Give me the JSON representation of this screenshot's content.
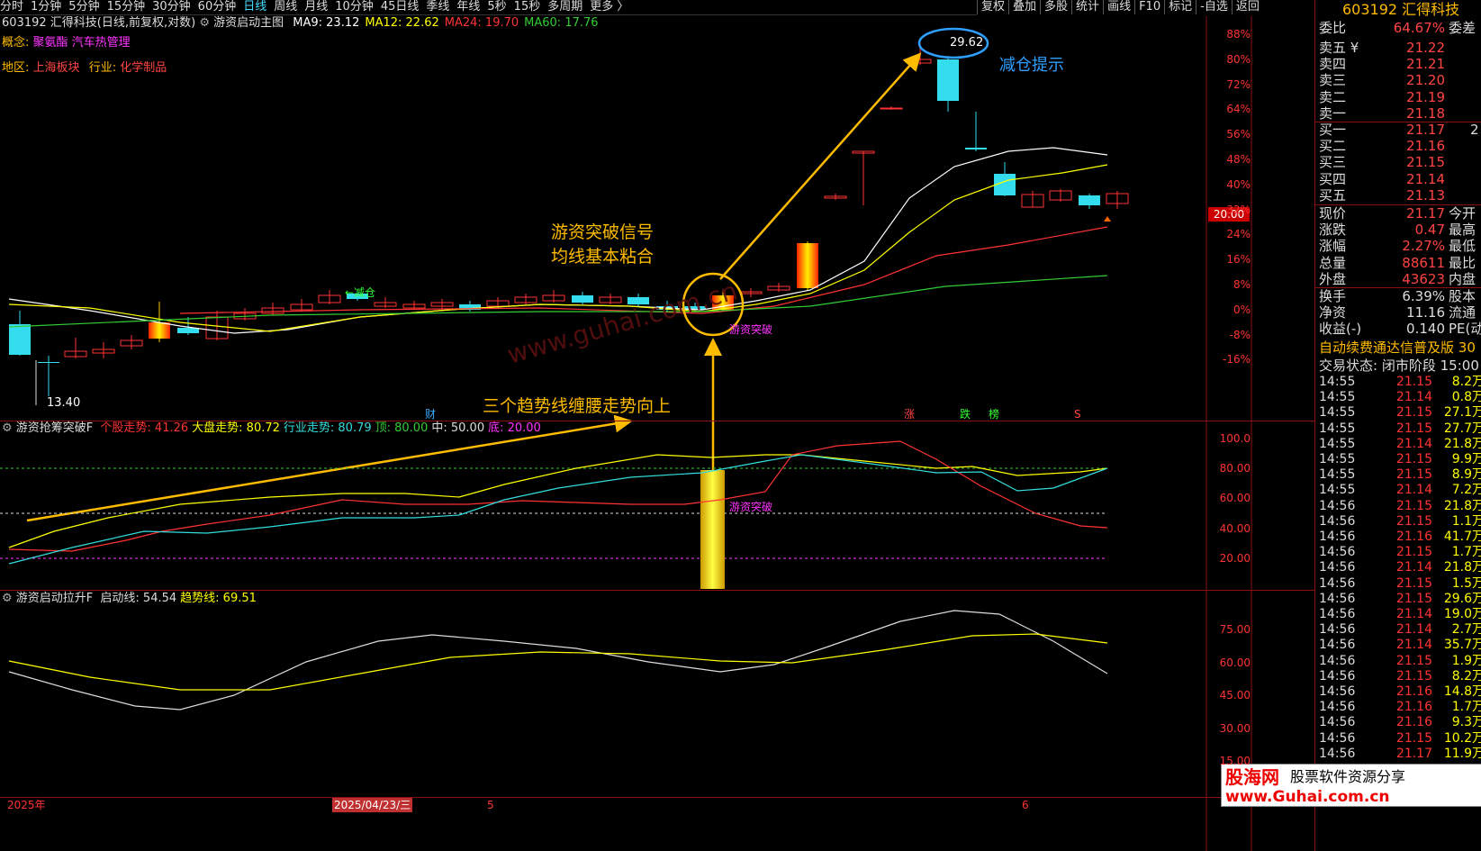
{
  "toolbar": {
    "periods": [
      "分时",
      "1分钟",
      "5分钟",
      "15分钟",
      "30分钟",
      "60分钟",
      "日线",
      "周线",
      "月线",
      "10分钟",
      "45日线",
      "季线",
      "年线",
      "5秒",
      "15秒",
      "多周期",
      "更多 〉"
    ],
    "active": "日线",
    "right_tools": [
      "复权",
      "叠加",
      "多股",
      "统计",
      "画线",
      "F10",
      "标记",
      "-自选",
      "返回"
    ]
  },
  "main_chart": {
    "header": "603192 汇得科技(日线,前复权,对数)",
    "indicator_name": "游资启动主图",
    "ma": [
      {
        "label": "MA9: 23.12",
        "color": "#ffffff"
      },
      {
        "label": "MA12: 22.62",
        "color": "#ffff00"
      },
      {
        "label": "MA24: 19.70",
        "color": "#ff3333"
      },
      {
        "label": "MA60: 17.76",
        "color": "#33cc33"
      }
    ],
    "concept_label": "概念:",
    "concepts": "聚氨酯  汽车热管理",
    "region_label": "地区:",
    "region": "上海板块",
    "industry_label": "行业:",
    "industry": "化学制品",
    "high_label": "29.62",
    "high_tag": "减仓",
    "low_label": "13.40",
    "tag_reduce": "←减仓",
    "tag_break": "游资突破",
    "annotation_reduce": "减仓提示",
    "annotation_signal_1": "游资突破信号",
    "annotation_signal_2": "均线基本粘合",
    "annotation_trend": "三个趋势线缠腰走势向上",
    "watermark": "www.guhai.com.cn",
    "marks": [
      "财",
      "涨",
      "跌",
      "榜",
      "S"
    ],
    "price_tag": "20.00",
    "y_axis": [
      "88%",
      "80%",
      "72%",
      "64%",
      "56%",
      "48%",
      "40%",
      "32%",
      "24%",
      "16%",
      "8%",
      "0%",
      "-8%",
      "-16%"
    ]
  },
  "sub1": {
    "name": "游资抢筹突破F",
    "items": [
      {
        "label": "个股走势: 41.26",
        "color": "#ff3333"
      },
      {
        "label": "大盘走势: 80.72",
        "color": "#ffff00"
      },
      {
        "label": "行业走势: 80.79",
        "color": "#33dddd"
      },
      {
        "label": "顶: 80.00",
        "color": "#33cc33"
      },
      {
        "label": "中: 50.00",
        "color": "#dddddd"
      },
      {
        "label": "底: 20.00",
        "color": "#ff33ff"
      }
    ],
    "tag_break": "游资突破",
    "y_axis": [
      "100.0",
      "80.00",
      "60.00",
      "40.00",
      "20.00"
    ]
  },
  "sub2": {
    "name": "游资启动拉升F",
    "items": [
      {
        "label": "启动线: 54.54",
        "color": "#dddddd"
      },
      {
        "label": "趋势线: 69.51",
        "color": "#ffff00"
      }
    ],
    "y_axis": [
      "75.00",
      "60.00",
      "45.00",
      "30.00",
      "15.00"
    ]
  },
  "dates": [
    "2025年",
    "2025/04/23/三",
    "5",
    "6"
  ],
  "side": {
    "code": "603192",
    "name": "汇得科技",
    "weibi_label": "委比",
    "weibi": "64.67%",
    "weicha_label": "委差",
    "book": [
      {
        "k": "卖五 ¥",
        "v": "21.22"
      },
      {
        "k": "卖四",
        "v": "21.21"
      },
      {
        "k": "卖三",
        "v": "21.20"
      },
      {
        "k": "卖二",
        "v": "21.19"
      },
      {
        "k": "卖一",
        "v": "21.18"
      },
      {
        "k": "买一",
        "v": "21.17"
      },
      {
        "k": "买二",
        "v": "21.16"
      },
      {
        "k": "买三",
        "v": "21.15"
      },
      {
        "k": "买四",
        "v": "21.14"
      },
      {
        "k": "买五",
        "v": "21.13"
      }
    ],
    "buy1_vol": "2",
    "stats": [
      {
        "k": "现价",
        "v": "21.17",
        "k2": "今开"
      },
      {
        "k": "涨跌",
        "v": "0.47",
        "k2": "最高"
      },
      {
        "k": "涨幅",
        "v": "2.27%",
        "k2": "最低"
      },
      {
        "k": "总量",
        "v": "88611",
        "k2": "最比"
      },
      {
        "k": "外盘",
        "v": "43623",
        "k2": "内盘"
      }
    ],
    "stats2": [
      {
        "k": "换手",
        "v": "6.39%",
        "k2": "股本"
      },
      {
        "k": "净资",
        "v": "11.16",
        "k2": "流通"
      },
      {
        "k": "收益(-)",
        "v": "0.140",
        "k2": "PE(动)"
      }
    ],
    "ad": "自动续费通达信普及版",
    "ad_num": "30",
    "status_label": "交易状态:",
    "status": "闭市阶段",
    "status_time": "15:00",
    "ticks": [
      {
        "t": "14:55",
        "p": "21.15",
        "v": "8.2万"
      },
      {
        "t": "14:55",
        "p": "21.14",
        "v": "0.8万"
      },
      {
        "t": "14:55",
        "p": "21.15",
        "v": "27.1万"
      },
      {
        "t": "14:55",
        "p": "21.15",
        "v": "27.7万"
      },
      {
        "t": "14:55",
        "p": "21.14",
        "v": "21.8万"
      },
      {
        "t": "14:55",
        "p": "21.15",
        "v": "9.9万"
      },
      {
        "t": "14:55",
        "p": "21.15",
        "v": "8.9万"
      },
      {
        "t": "14:55",
        "p": "21.14",
        "v": "7.2万"
      },
      {
        "t": "14:56",
        "p": "21.15",
        "v": "21.8万"
      },
      {
        "t": "14:56",
        "p": "21.15",
        "v": "1.1万"
      },
      {
        "t": "14:56",
        "p": "21.16",
        "v": "41.7万"
      },
      {
        "t": "14:56",
        "p": "21.15",
        "v": "1.7万"
      },
      {
        "t": "14:56",
        "p": "21.14",
        "v": "21.8万"
      },
      {
        "t": "14:56",
        "p": "21.15",
        "v": "1.5万"
      },
      {
        "t": "14:56",
        "p": "21.15",
        "v": "29.6万"
      },
      {
        "t": "14:56",
        "p": "21.14",
        "v": "19.0万"
      },
      {
        "t": "14:56",
        "p": "21.14",
        "v": "2.7万"
      },
      {
        "t": "14:56",
        "p": "21.14",
        "v": "35.7万"
      },
      {
        "t": "14:56",
        "p": "21.15",
        "v": "1.9万"
      },
      {
        "t": "14:56",
        "p": "21.15",
        "v": "8.2万"
      },
      {
        "t": "14:56",
        "p": "21.16",
        "v": "14.8万"
      },
      {
        "t": "14:56",
        "p": "21.16",
        "v": "1.7万"
      },
      {
        "t": "14:56",
        "p": "21.16",
        "v": "9.3万"
      },
      {
        "t": "14:56",
        "p": "21.15",
        "v": "10.2万"
      },
      {
        "t": "14:56",
        "p": "21.17",
        "v": "11.9万"
      }
    ],
    "logo_cn": "股海网",
    "logo_slogan": "股票软件资源分享",
    "logo_url": "www.Guhai.com.cn"
  },
  "colors": {
    "up": "#ff3333",
    "down": "#33ddee",
    "accent": "#ffbb00",
    "border": "#8a1010"
  }
}
